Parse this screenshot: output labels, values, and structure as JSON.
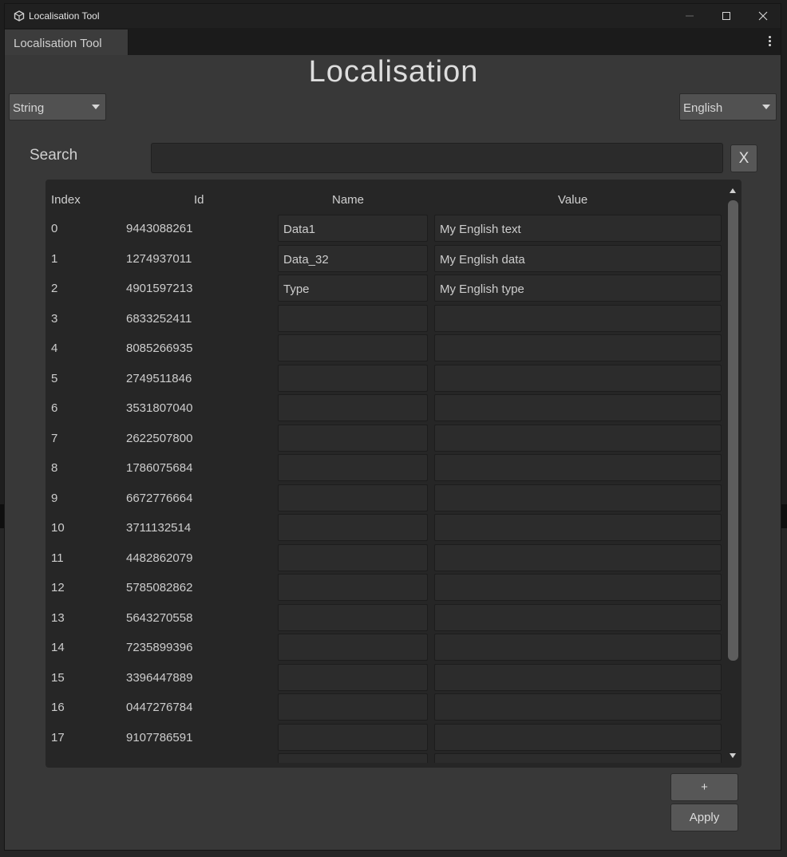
{
  "window": {
    "title": "Localisation Tool",
    "tab_label": "Localisation Tool"
  },
  "heading": "Localisation",
  "type_dropdown": {
    "selected": "String"
  },
  "language_dropdown": {
    "selected": "English"
  },
  "search": {
    "label": "Search",
    "value": "",
    "clear_label": "X"
  },
  "table": {
    "headers": {
      "index": "Index",
      "id": "Id",
      "name": "Name",
      "value": "Value"
    },
    "rows": [
      {
        "index": "0",
        "id": "9443088261",
        "name": "Data1",
        "value": "My English text"
      },
      {
        "index": "1",
        "id": "1274937011",
        "name": "Data_32",
        "value": "My English data"
      },
      {
        "index": "2",
        "id": "4901597213",
        "name": "Type",
        "value": "My English type"
      },
      {
        "index": "3",
        "id": "6833252411",
        "name": "",
        "value": ""
      },
      {
        "index": "4",
        "id": "8085266935",
        "name": "",
        "value": ""
      },
      {
        "index": "5",
        "id": "2749511846",
        "name": "",
        "value": ""
      },
      {
        "index": "6",
        "id": "3531807040",
        "name": "",
        "value": ""
      },
      {
        "index": "7",
        "id": "2622507800",
        "name": "",
        "value": ""
      },
      {
        "index": "8",
        "id": "1786075684",
        "name": "",
        "value": ""
      },
      {
        "index": "9",
        "id": "6672776664",
        "name": "",
        "value": ""
      },
      {
        "index": "10",
        "id": "3711132514",
        "name": "",
        "value": ""
      },
      {
        "index": "11",
        "id": "4482862079",
        "name": "",
        "value": ""
      },
      {
        "index": "12",
        "id": "5785082862",
        "name": "",
        "value": ""
      },
      {
        "index": "13",
        "id": "5643270558",
        "name": "",
        "value": ""
      },
      {
        "index": "14",
        "id": "7235899396",
        "name": "",
        "value": ""
      },
      {
        "index": "15",
        "id": "3396447889",
        "name": "",
        "value": ""
      },
      {
        "index": "16",
        "id": "0447276784",
        "name": "",
        "value": ""
      },
      {
        "index": "17",
        "id": "9107786591",
        "name": "",
        "value": ""
      },
      {
        "index": "",
        "id": "",
        "name": "",
        "value": ""
      }
    ]
  },
  "buttons": {
    "add": "+",
    "apply": "Apply"
  }
}
